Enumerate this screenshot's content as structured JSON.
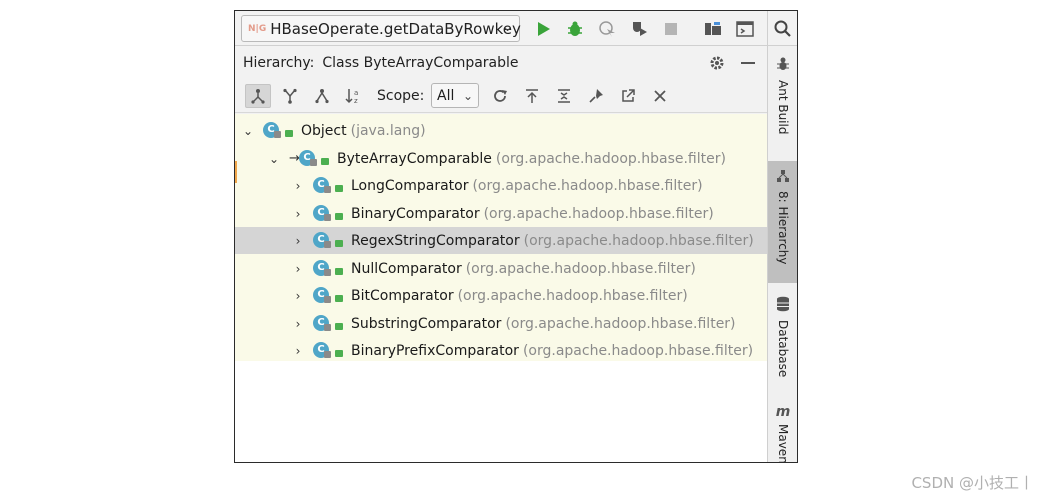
{
  "run_config": {
    "name": "HBaseOperate.getDataByRowkey",
    "icon": "spring-config-icon"
  },
  "toolbar": {
    "icons": [
      "run-icon",
      "debug-icon",
      "coverage-icon",
      "profile-icon",
      "stop-icon",
      "project-structure-icon",
      "terminal-icon",
      "search-icon"
    ],
    "colors": {
      "run": "#3aa43a",
      "debug": "#3aa43a",
      "disabled": "#9a9a9a"
    }
  },
  "panel": {
    "title": "Hierarchy:",
    "subtitle": "Class ByteArrayComparable",
    "scope_label": "Scope:",
    "scope_value": "All"
  },
  "side_tabs": [
    {
      "label": "Ant Build",
      "icon": "ant-icon"
    },
    {
      "label": "8: Hierarchy",
      "icon": "hierarchy-icon",
      "active": true
    },
    {
      "label": "Database",
      "icon": "database-icon"
    },
    {
      "label": "Maven",
      "icon": "maven-icon"
    }
  ],
  "tree": [
    {
      "name": "Object",
      "pkg": "(java.lang)",
      "expanded": true
    },
    {
      "name": "ByteArrayComparable",
      "pkg": "(org.apache.hadoop.hbase.filter)",
      "expanded": true
    },
    {
      "name": "LongComparator",
      "pkg": "(org.apache.hadoop.hbase.filter)"
    },
    {
      "name": "BinaryComparator",
      "pkg": "(org.apache.hadoop.hbase.filter)"
    },
    {
      "name": "RegexStringComparator",
      "pkg": "(org.apache.hadoop.hbase.filter)",
      "selected": true
    },
    {
      "name": "NullComparator",
      "pkg": "(org.apache.hadoop.hbase.filter)"
    },
    {
      "name": "BitComparator",
      "pkg": "(org.apache.hadoop.hbase.filter)"
    },
    {
      "name": "SubstringComparator",
      "pkg": "(org.apache.hadoop.hbase.filter)"
    },
    {
      "name": "BinaryPrefixComparator",
      "pkg": "(org.apache.hadoop.hbase.filter)"
    }
  ],
  "watermark": "CSDN @小技工丨"
}
